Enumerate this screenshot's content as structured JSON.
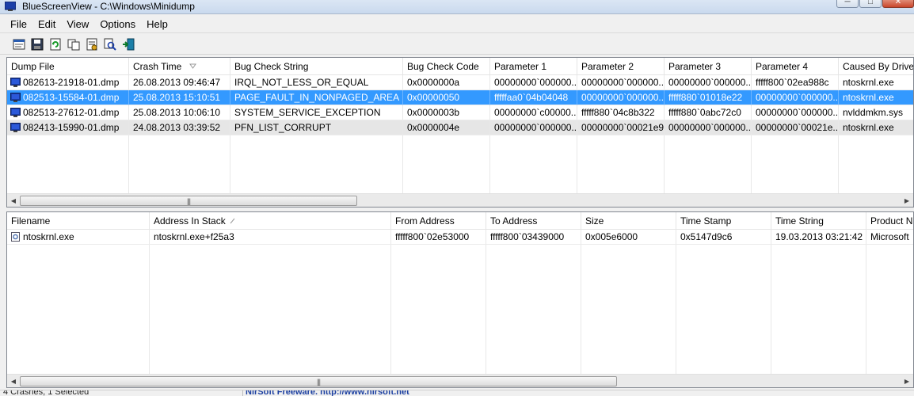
{
  "window": {
    "title": "BlueScreenView  -  C:\\Windows\\Minidump",
    "min_symbol": "─",
    "max_symbol": "□",
    "close_symbol": "✕"
  },
  "menu": [
    "File",
    "Edit",
    "View",
    "Options",
    "Help"
  ],
  "toolbar": [
    {
      "name": "html-report-icon"
    },
    {
      "name": "save-icon"
    },
    {
      "name": "refresh-icon"
    },
    {
      "name": "copy-icon"
    },
    {
      "name": "properties-icon"
    },
    {
      "name": "find-icon"
    },
    {
      "name": "exit-icon"
    }
  ],
  "dump_table": {
    "columns": [
      "Dump File",
      "Crash Time",
      "Bug Check String",
      "Bug Check Code",
      "Parameter 1",
      "Parameter 2",
      "Parameter 3",
      "Parameter 4",
      "Caused By Driver"
    ],
    "rows": [
      [
        "082613-21918-01.dmp",
        "26.08.2013 09:46:47",
        "IRQL_NOT_LESS_OR_EQUAL",
        "0x0000000a",
        "00000000`000000...",
        "00000000`000000...",
        "00000000`000000...",
        "fffff800`02ea988c",
        "ntoskrnl.exe"
      ],
      [
        "082513-15584-01.dmp",
        "25.08.2013 15:10:51",
        "PAGE_FAULT_IN_NONPAGED_AREA",
        "0x00000050",
        "fffffaa0`04b04048",
        "00000000`000000...",
        "fffff880`01018e22",
        "00000000`000000...",
        "ntoskrnl.exe"
      ],
      [
        "082513-27612-01.dmp",
        "25.08.2013 10:06:10",
        "SYSTEM_SERVICE_EXCEPTION",
        "0x0000003b",
        "00000000`c00000...",
        "fffff880`04c8b322",
        "fffff880`0abc72c0",
        "00000000`000000...",
        "nvlddmkm.sys"
      ],
      [
        "082413-15990-01.dmp",
        "24.08.2013 03:39:52",
        "PFN_LIST_CORRUPT",
        "0x0000004e",
        "00000000`000000...",
        "00000000`00021e9f",
        "00000000`000000...",
        "00000000`00021e...",
        "ntoskrnl.exe"
      ]
    ],
    "selected_row": 1,
    "sorted_column": "Crash Time"
  },
  "module_table": {
    "columns": [
      "Filename",
      "Address In Stack",
      "From Address",
      "To Address",
      "Size",
      "Time Stamp",
      "Time String",
      "Product N"
    ],
    "rows": [
      [
        "ntoskrnl.exe",
        "ntoskrnl.exe+f25a3",
        "fffff800`02e53000",
        "fffff800`03439000",
        "0x005e6000",
        "0x5147d9c6",
        "19.03.2013 03:21:42",
        "Microsoft"
      ]
    ],
    "sorted_column": "Address In Stack"
  },
  "scroll": {
    "grip": "|||",
    "left_arrow": "◀",
    "right_arrow": "▶"
  },
  "status": {
    "left": "4 Crashes, 1 Selected",
    "link": "NirSoft Freeware.  http://www.nirsoft.net"
  },
  "colors": {
    "selection": "#3399ff",
    "gray_row": "#e6e6e6",
    "dump_icon": "#1c3fa8"
  }
}
